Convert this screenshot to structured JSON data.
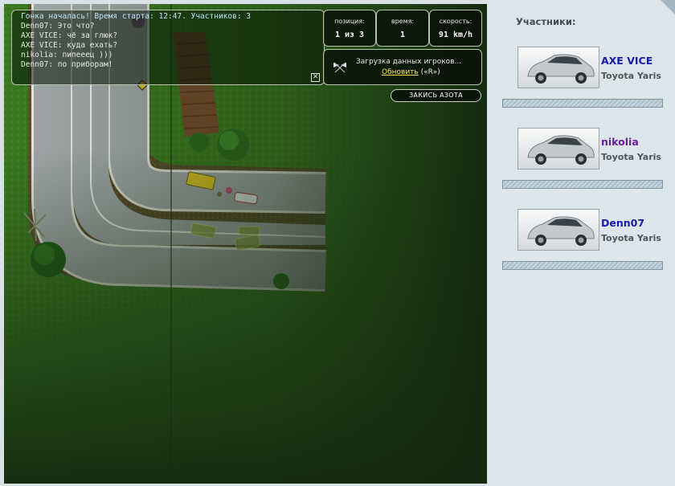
{
  "chat": {
    "lines": [
      "Гонка началась! Время старта: 12:47. Участников: 3",
      "Denn07: Это что?",
      "AXE VICE: чё за глюк?",
      "AXE VICE: куда ехать?",
      "nikolia: пипееец )))",
      "Denn07: по приборам!"
    ],
    "close_icon": "close-icon"
  },
  "stats": {
    "position": {
      "label": "позиция:",
      "value": "1 из 3"
    },
    "time": {
      "label": "время:",
      "value": "1"
    },
    "speed": {
      "label": "скорость:",
      "value": "91 km/h"
    }
  },
  "loading": {
    "text": "Загрузка данных игроков...",
    "refresh_label": "Обновить",
    "hotkey": " («R»)",
    "icon": "checkered-flag-icon"
  },
  "nitro_button": "ЗАКИСЬ АЗОТА",
  "panel": {
    "title": "Участники:",
    "players": [
      {
        "name": "AXE VICE",
        "car": "Toyota Yaris",
        "color": "#1a1aa8"
      },
      {
        "name": "nikolia",
        "car": "Toyota Yaris",
        "color": "#6a1e9a"
      },
      {
        "name": "Denn07",
        "car": "Toyota Yaris",
        "color": "#1a1aa8"
      }
    ]
  },
  "colors": {
    "grass": "#3d7a22",
    "road": "#a3a8aa",
    "dark_fog": "#142a10",
    "panel_bg": "#dbe5ea"
  }
}
